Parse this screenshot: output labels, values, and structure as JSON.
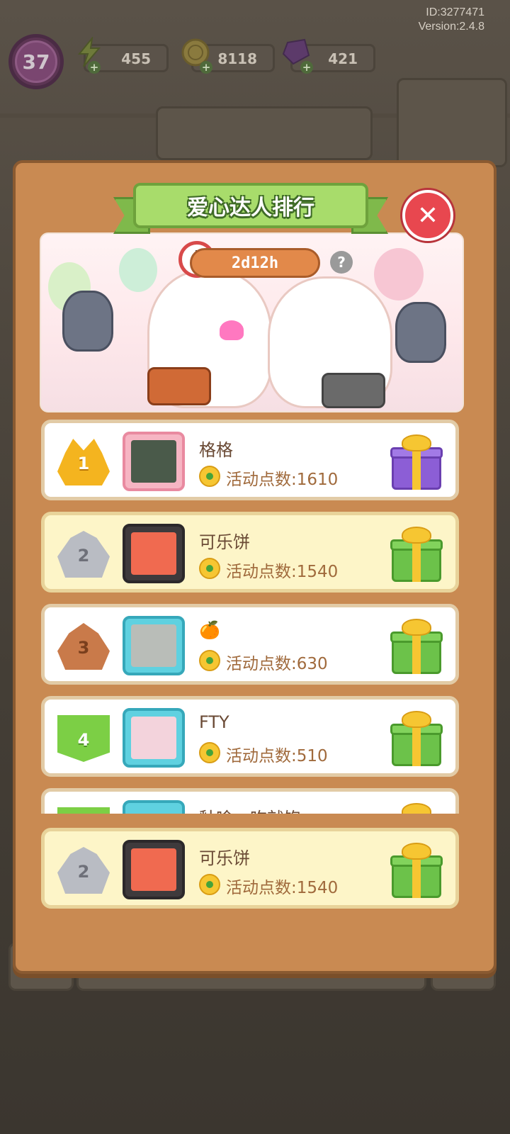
{
  "info": {
    "user_id": "ID:3277471",
    "version": "Version:2.4.8"
  },
  "top_bar": {
    "level": "37",
    "energy": "455",
    "coins": "8118",
    "gems": "421"
  },
  "panel": {
    "title": "爱心达人排行",
    "timer": "2d12h",
    "help_label": "?",
    "close_label": "✕"
  },
  "ranking": [
    {
      "rank": "1",
      "name": "格格",
      "points": "活动点数:1610",
      "reward": "purple-gift-icon"
    },
    {
      "rank": "2",
      "name": "可乐饼",
      "points": "活动点数:1540",
      "reward": "green-gift-icon"
    },
    {
      "rank": "3",
      "name": "🍊",
      "points": "活动点数:630",
      "reward": "green-gift-icon"
    },
    {
      "rank": "4",
      "name": "FTY",
      "points": "活动点数:510",
      "reward": "green-gift-icon"
    },
    {
      "rank": "",
      "name": "釉啥一吃就饱",
      "points": "",
      "reward": "green-gift-icon"
    }
  ],
  "my_rank": {
    "rank": "2",
    "name": "可乐饼",
    "points": "活动点数:1540"
  },
  "colors": {
    "title_green": "#a8dc6b",
    "panel_brown": "#c98a52",
    "close_red": "#e8474f",
    "highlight_row": "#fdf5c8"
  }
}
